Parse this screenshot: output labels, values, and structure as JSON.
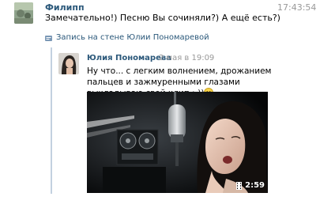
{
  "message": {
    "sender_name": "Филипп",
    "time": "17:43:54",
    "text": "Замечательно!) Песню Вы сочиняли?) А ещё есть?)"
  },
  "wall_link": {
    "label": "Запись на стене Юлии Пономаревой",
    "icon": "wall-post-icon"
  },
  "post": {
    "author": "Юлия Пономарева",
    "date": "2 мая в 19:09",
    "text": "Ну что... с легким волнением, дрожанием пальцев и зажмуренными глазами выкладываю свой клип :-))",
    "emoji": "smile-emoji",
    "video": {
      "duration": "2:59"
    }
  },
  "colors": {
    "link": "#2b587a",
    "muted": "#999999",
    "quote_bar": "#c3d1e0"
  }
}
